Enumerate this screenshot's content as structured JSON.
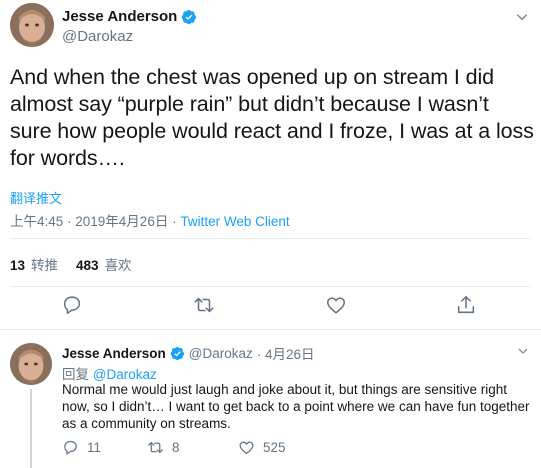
{
  "tweet": {
    "author_name": "Jesse Anderson",
    "author_handle": "@Darokaz",
    "text": "And when the chest was opened up on stream I did almost say “purple rain” but didn’t because I wasn’t sure how people would react and I froze, I was at a loss for words….",
    "translate_label": "翻译推文",
    "timestamp": "上午4:45 · 2019年4月26日",
    "separator": " · ",
    "client": "Twitter Web Client",
    "retweets_count": "13",
    "retweets_label": "转推",
    "likes_count": "483",
    "likes_label": "喜欢"
  },
  "reply": {
    "author_name": "Jesse Anderson",
    "author_handle": "@Darokaz",
    "date": "· 4月26日",
    "replying_to_label": "回复",
    "replying_to_handle": "@Darokaz",
    "text": "Normal me would just laugh and joke about it, but things are sensitive right now, so I didn’t… I want to get back to a point where we can have fun together as a community on streams.",
    "reply_count": "11",
    "retweet_count": "8",
    "like_count": "525"
  },
  "colors": {
    "accent": "#1da1f2",
    "secondary_text": "#657786",
    "primary_text": "#14171a",
    "border": "#e6ecf0"
  },
  "icons": {
    "verified": "verified-badge-icon",
    "caret": "chevron-down-icon",
    "reply": "reply-bubble-icon",
    "retweet": "retweet-icon",
    "like": "heart-icon",
    "share": "share-icon"
  }
}
